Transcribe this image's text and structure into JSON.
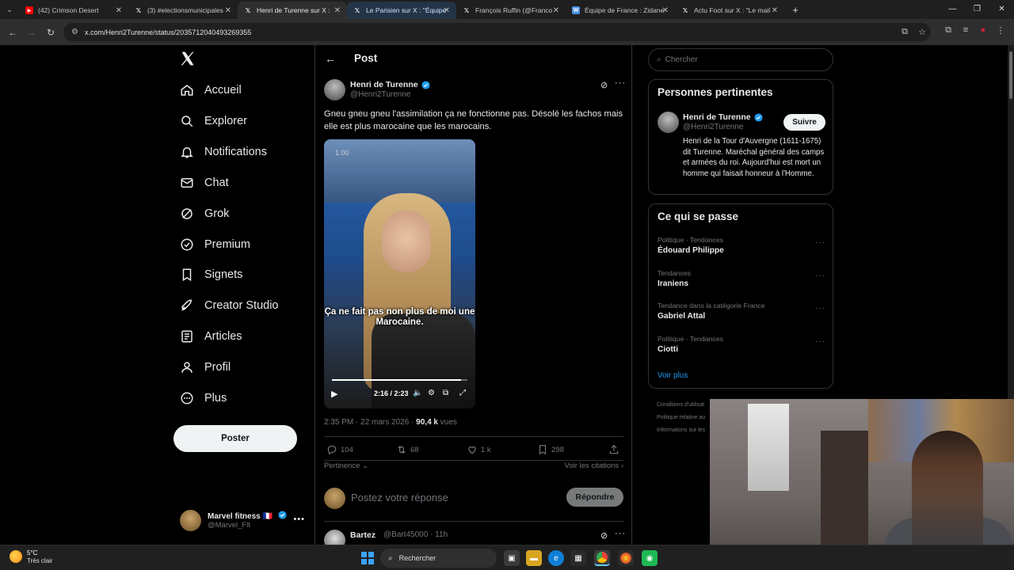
{
  "browser": {
    "tabs": [
      {
        "label": "(42) Crimson Desert",
        "icon": "youtube-icon",
        "color": "#ff0000",
        "active": false
      },
      {
        "label": "(3) #electionsmunicipales",
        "icon": "x-logo-icon",
        "color": "#ffffff",
        "active": false
      },
      {
        "label": "Henri de Turenne sur X : ",
        "icon": "x-logo-icon",
        "color": "#ffffff",
        "active": true
      },
      {
        "label": "Le Parisien sur X : \"Équipe",
        "icon": "x-logo-icon",
        "color": "#ffffff",
        "active": false
      },
      {
        "label": "François Ruffin (@Franco",
        "icon": "x-logo-icon",
        "color": "#ffffff",
        "active": false
      },
      {
        "label": "Équipe de France : Zidane",
        "icon": "wikipedia-icon",
        "color": "#4a90e2",
        "active": false
      },
      {
        "label": "Actu Foot sur X : \"Le mail",
        "icon": "x-logo-icon",
        "color": "#ffffff",
        "active": false
      }
    ],
    "url": "x.com/Henri2Turenne/status/2035712040493269355"
  },
  "nav": {
    "items": [
      {
        "label": "Accueil",
        "icon": "home-icon"
      },
      {
        "label": "Explorer",
        "icon": "search-icon"
      },
      {
        "label": "Notifications",
        "icon": "bell-icon"
      },
      {
        "label": "Chat",
        "icon": "mail-icon"
      },
      {
        "label": "Grok",
        "icon": "grok-icon"
      },
      {
        "label": "Premium",
        "icon": "premium-icon"
      },
      {
        "label": "Signets",
        "icon": "bookmark-icon"
      },
      {
        "label": "Creator Studio",
        "icon": "rocket-icon"
      },
      {
        "label": "Articles",
        "icon": "article-icon"
      },
      {
        "label": "Profil",
        "icon": "person-icon"
      },
      {
        "label": "Plus",
        "icon": "more-circle-icon"
      }
    ],
    "post_label": "Poster",
    "account": {
      "name": "Marvel fitness 🇫🇷",
      "handle": "@Marvel_Flt"
    }
  },
  "main": {
    "header_title": "Post",
    "post": {
      "author_name": "Henri de Turenne",
      "author_handle": "@Henri2Turenne",
      "text": "Gneu gneu gneu l'assimilation ça ne fonctionne pas. Désolé les fachos mais elle est plus marocaine que les marocains.",
      "video": {
        "speed_label": "1.00",
        "caption": "Ça ne fait pas non plus de moi une Marocaine.",
        "time": "2:16 / 2:23",
        "progress": 0.951
      },
      "timestamp": "2:35 PM · 22 mars 2026 · ",
      "views_count": "90,4 k",
      "views_label": " vues",
      "stats": {
        "replies": "104",
        "reposts": "68",
        "likes": "1 k",
        "bookmarks": "298"
      }
    },
    "sort_label": "Pertinence",
    "citations_label": "Voir les citations",
    "reply_placeholder": "Postez votre réponse",
    "reply_button": "Répondre",
    "first_reply": {
      "name": "Bartez",
      "handle": "@Bart45000 · 11h"
    }
  },
  "right": {
    "search_placeholder": "Chercher",
    "people_title": "Personnes pertinentes",
    "person": {
      "name": "Henri de Turenne",
      "handle": "@Henri2Turenne",
      "follow_label": "Suivre",
      "bio": "Henri de la Tour d'Auvergne (1611-1675) dit Turenne. Maréchal général des camps et armées du roi. Aujourd'hui est mort un homme qui faisait honneur à l'Homme."
    },
    "trending_title": "Ce qui se passe",
    "trends": [
      {
        "category": "Politique · Tendances",
        "name": "Édouard Philippe"
      },
      {
        "category": "Tendances",
        "name": "Iraniens"
      },
      {
        "category": "Tendance dans la catégorie France",
        "name": "Gabriel Attal"
      },
      {
        "category": "Politique · Tendances",
        "name": "Ciotti"
      }
    ],
    "see_more": "Voir plus",
    "footer": [
      "Conditions d'utilisat",
      "Politique relative au",
      "Informations sur les"
    ]
  },
  "taskbar": {
    "weather_temp": "5°C",
    "weather_desc": "Très clair",
    "search_label": "Rechercher"
  },
  "colors": {
    "accent": "#1d9bf0",
    "background": "#000000",
    "border": "#2f3336",
    "muted": "#71767b"
  }
}
